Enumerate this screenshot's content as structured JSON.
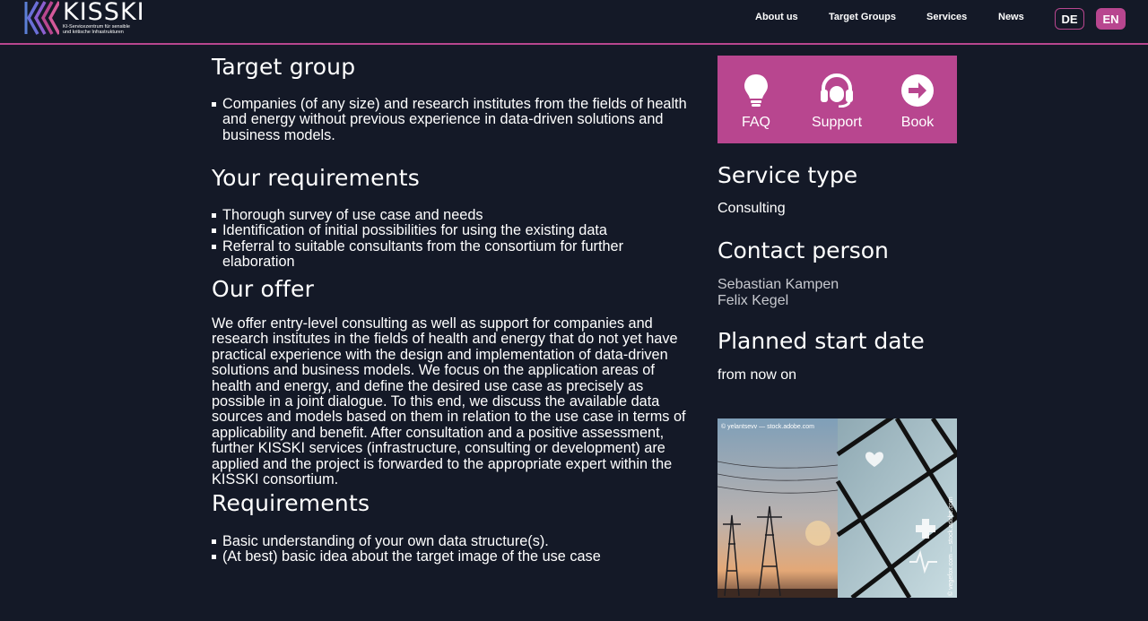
{
  "header": {
    "logo_name": "KISSKI",
    "logo_sub_line1": "KI-Servicezentrum für sensible",
    "logo_sub_line2": "und kritische Infrastrukturen",
    "nav": {
      "about": "About us",
      "target_groups": "Target Groups",
      "services": "Services",
      "news": "News"
    },
    "lang_de": "DE",
    "lang_en": "EN"
  },
  "colors": {
    "background": "#141927",
    "accent": "#b8468f"
  },
  "main": {
    "target_group": {
      "heading": "Target group",
      "items": [
        "Companies (of any size) and research institutes from the fields of health and energy without previous experience in data-driven solutions and business models."
      ]
    },
    "requirements_yours": {
      "heading": "Your requirements",
      "items": [
        "Thorough survey of use case and needs",
        "Identification of initial possibilities for using the existing data",
        "Referral to suitable consultants from the consortium for further elaboration"
      ]
    },
    "offer": {
      "heading": "Our offer",
      "text": "We offer entry-level consulting as well as support for companies and research institutes in the fields of health and energy that do not yet have practical experience with the design and implementation of data-driven solutions and business models. We focus on the application areas of health and energy, and define the desired use case as precisely as possible in a joint dialogue. To this end, we discuss the available data sources and models based on them in relation to the use case in terms of applicability and benefit. After consultation and a positive assessment, further KISSKI services (infrastructure, consulting or development) are applied and the project is forwarded to the appropriate expert within the KISSKI consortium."
    },
    "requirements": {
      "heading": "Requirements",
      "items": [
        "Basic understanding of your own data structure(s).",
        "(At best) basic idea about the target image of the use case"
      ]
    }
  },
  "sidebar": {
    "actions": [
      {
        "label": "FAQ",
        "icon": "lightbulb-icon"
      },
      {
        "label": "Support",
        "icon": "headset-icon"
      },
      {
        "label": "Book",
        "icon": "arrow-right-circle-icon"
      }
    ],
    "service_type": {
      "heading": "Service type",
      "value": "Consulting"
    },
    "contact": {
      "heading": "Contact person",
      "names": [
        "Sebastian Kampen",
        "Felix Kegel"
      ]
    },
    "start_date": {
      "heading": "Planned start date",
      "value": "from now on"
    },
    "image": {
      "credit_top": "© yelantsevv — stock.adobe.com",
      "credit_side": "© vegefox.com — stock.adobe.com"
    }
  }
}
